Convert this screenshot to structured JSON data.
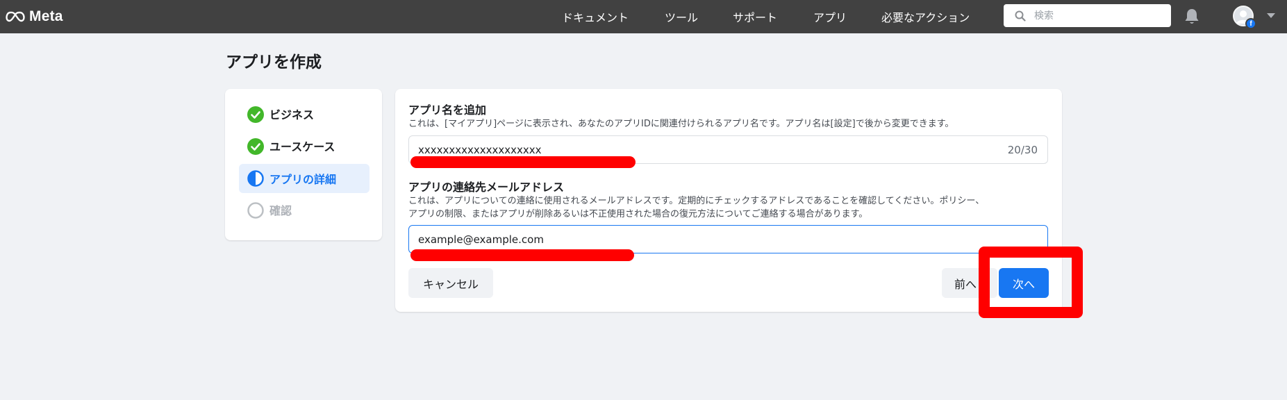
{
  "brand": {
    "name": "Meta",
    "color": "#ffffff"
  },
  "nav": {
    "items": [
      "ドキュメント",
      "ツール",
      "サポート",
      "アプリ",
      "必要なアクション"
    ]
  },
  "search": {
    "placeholder": "検索",
    "value": ""
  },
  "header_icons": {
    "notifications": "bell-icon",
    "account": "avatar",
    "badge": "f"
  },
  "page": {
    "title": "アプリを作成"
  },
  "steps": [
    {
      "label": "ビジネス",
      "state": "complete"
    },
    {
      "label": "ユースケース",
      "state": "complete"
    },
    {
      "label": "アプリの詳細",
      "state": "active"
    },
    {
      "label": "確認",
      "state": "pending"
    }
  ],
  "form": {
    "app_name": {
      "title": "アプリ名を追加",
      "description": "これは、[マイアプリ]ページに表示され、あなたのアプリIDに関連付けられるアプリ名です。アプリ名は[設定]で後から変更できます。",
      "value": "xxxxxxxxxxxxxxxxxxxx",
      "counter": "20/30"
    },
    "email": {
      "title": "アプリの連絡先メールアドレス",
      "description_line1": "これは、アプリについての連絡に使用されるメールアドレスです。定期的にチェックするアドレスであることを確認してください。ポリシー、",
      "description_line2": "アプリの制限、またはアプリが削除あるいは不正使用された場合の復元方法についてご連絡する場合があります。",
      "value": "example@example.com"
    },
    "buttons": {
      "cancel": "キャンセル",
      "previous": "前へ",
      "next": "次へ"
    }
  },
  "colors": {
    "topbar": "#414141",
    "primary": "#1877f2",
    "success": "#42b72a",
    "annotation": "#ff0000",
    "background": "#f0f2f5"
  }
}
